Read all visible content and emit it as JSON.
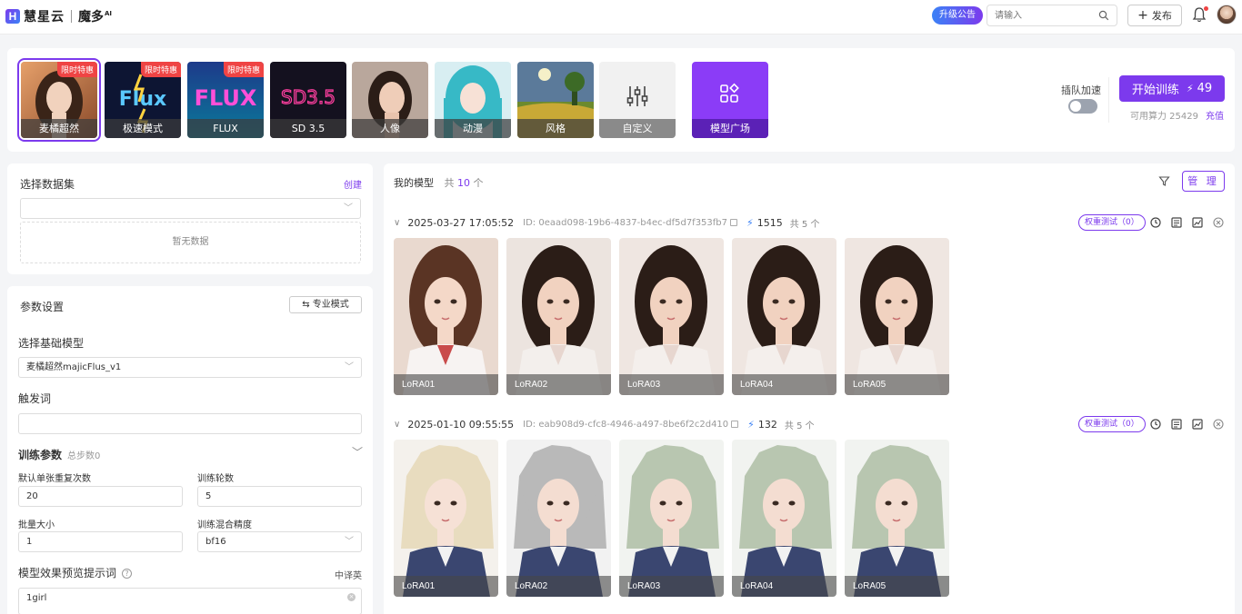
{
  "header": {
    "logo_mark": "H",
    "brand": "慧星云",
    "product": "魔多",
    "product_sup": "AI",
    "announcement": "升级公告",
    "search_placeholder": "请输入",
    "publish_label": "发布"
  },
  "model_strip": {
    "cards": [
      {
        "label": "麦橘超然",
        "badge": "限时特惠",
        "active": true
      },
      {
        "label": "极速模式",
        "badge": "限时特惠",
        "art_text": "Flux"
      },
      {
        "label": "FLUX",
        "badge": "限时特惠",
        "art_text": "FLUX"
      },
      {
        "label": "SD 3.5",
        "art_text": "SD3.5"
      },
      {
        "label": "人像"
      },
      {
        "label": "动漫"
      },
      {
        "label": "风格"
      },
      {
        "label": "自定义"
      },
      {
        "label": "模型广场"
      }
    ],
    "queue_label": "插队加速",
    "queue_enabled": false,
    "train_label": "开始训练",
    "train_cost": "49",
    "compute_label": "可用算力 25429",
    "recharge_label": "充值"
  },
  "dataset": {
    "title": "选择数据集",
    "create_label": "创建",
    "select_value": "",
    "empty_text": "暂无数据"
  },
  "params": {
    "title": "参数设置",
    "pro_mode_label": "专业模式",
    "base_model_label": "选择基础模型",
    "base_model_value": "麦橘超然majicFlus_v1",
    "trigger_label": "触发词",
    "trigger_value": "",
    "train_params_label": "训练参数",
    "total_steps": "总步数0",
    "repeat_label": "默认单张重复次数",
    "repeat_value": "20",
    "epochs_label": "训练轮数",
    "epochs_value": "5",
    "batch_label": "批量大小",
    "batch_value": "1",
    "precision_label": "训练混合精度",
    "precision_value": "bf16",
    "prompt_label": "模型效果预览提示词",
    "translate_label": "中译英",
    "prompt_value": "1girl"
  },
  "my_models": {
    "title": "我的模型",
    "count_prefix": "共",
    "count": "10",
    "count_suffix": "个",
    "manage_label": "管 理",
    "groups": [
      {
        "date": "2025-03-27 17:05:52",
        "id": "ID: 0eaad098-19b6-4837-b4ec-df5d7f353fb7",
        "cost": "1515",
        "total": "共 5 个",
        "weight_test": "权重测试（0）",
        "items": [
          "LoRA01",
          "LoRA02",
          "LoRA03",
          "LoRA04",
          "LoRA05"
        ]
      },
      {
        "date": "2025-01-10 09:55:55",
        "id": "ID: eab908d9-cfc8-4946-a497-8be6f2c2d410",
        "cost": "132",
        "total": "共 5 个",
        "weight_test": "权重测试（0）",
        "items": [
          "LoRA01",
          "LoRA02",
          "LoRA03",
          "LoRA04",
          "LoRA05"
        ]
      }
    ]
  },
  "icons": {
    "search": "search-icon",
    "bell": "bell-icon",
    "filter": "filter-icon",
    "bolt": "lightning-icon",
    "copy": "copy-icon"
  },
  "colors": {
    "accent": "#7c3aed",
    "badge": "#ef4444",
    "bolt": "#3b82f6"
  }
}
